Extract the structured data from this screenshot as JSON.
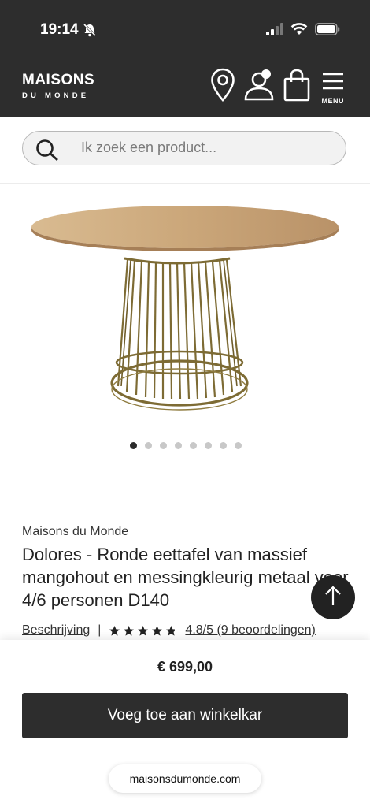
{
  "status_bar": {
    "time": "19:14",
    "icons": [
      "bell-slash-icon",
      "signal-icon",
      "wifi-icon",
      "battery-icon"
    ]
  },
  "header": {
    "logo_top": "MAISONS",
    "logo_bottom": "DU MONDE",
    "icons": [
      "store-locator-icon",
      "account-icon",
      "cart-icon",
      "menu-icon"
    ],
    "menu_label": "MENU"
  },
  "search": {
    "placeholder": "Ik zoek een product..."
  },
  "gallery": {
    "image_count": 8,
    "active_index": 0
  },
  "product": {
    "brand": "Maisons du Monde",
    "title": "Dolores - Ronde eettafel van massief mangohout en messingkleurig metaal voor 4/6 personen D140",
    "description_link": "Beschrijving",
    "separator": "|",
    "rating_text": "4.8/5 (9 beoordelingen)",
    "rating_value": 4.8,
    "rating_max": 5
  },
  "purchase": {
    "price": "€ 699,00",
    "add_to_cart_label": "Voeg toe aan winkelkar"
  },
  "browser": {
    "url": "maisonsdumonde.com"
  },
  "colors": {
    "header_bg": "#2d2d2d",
    "button_bg": "#2d2d2d",
    "wood": "#c9a77e",
    "brass": "#8c7a3b"
  }
}
